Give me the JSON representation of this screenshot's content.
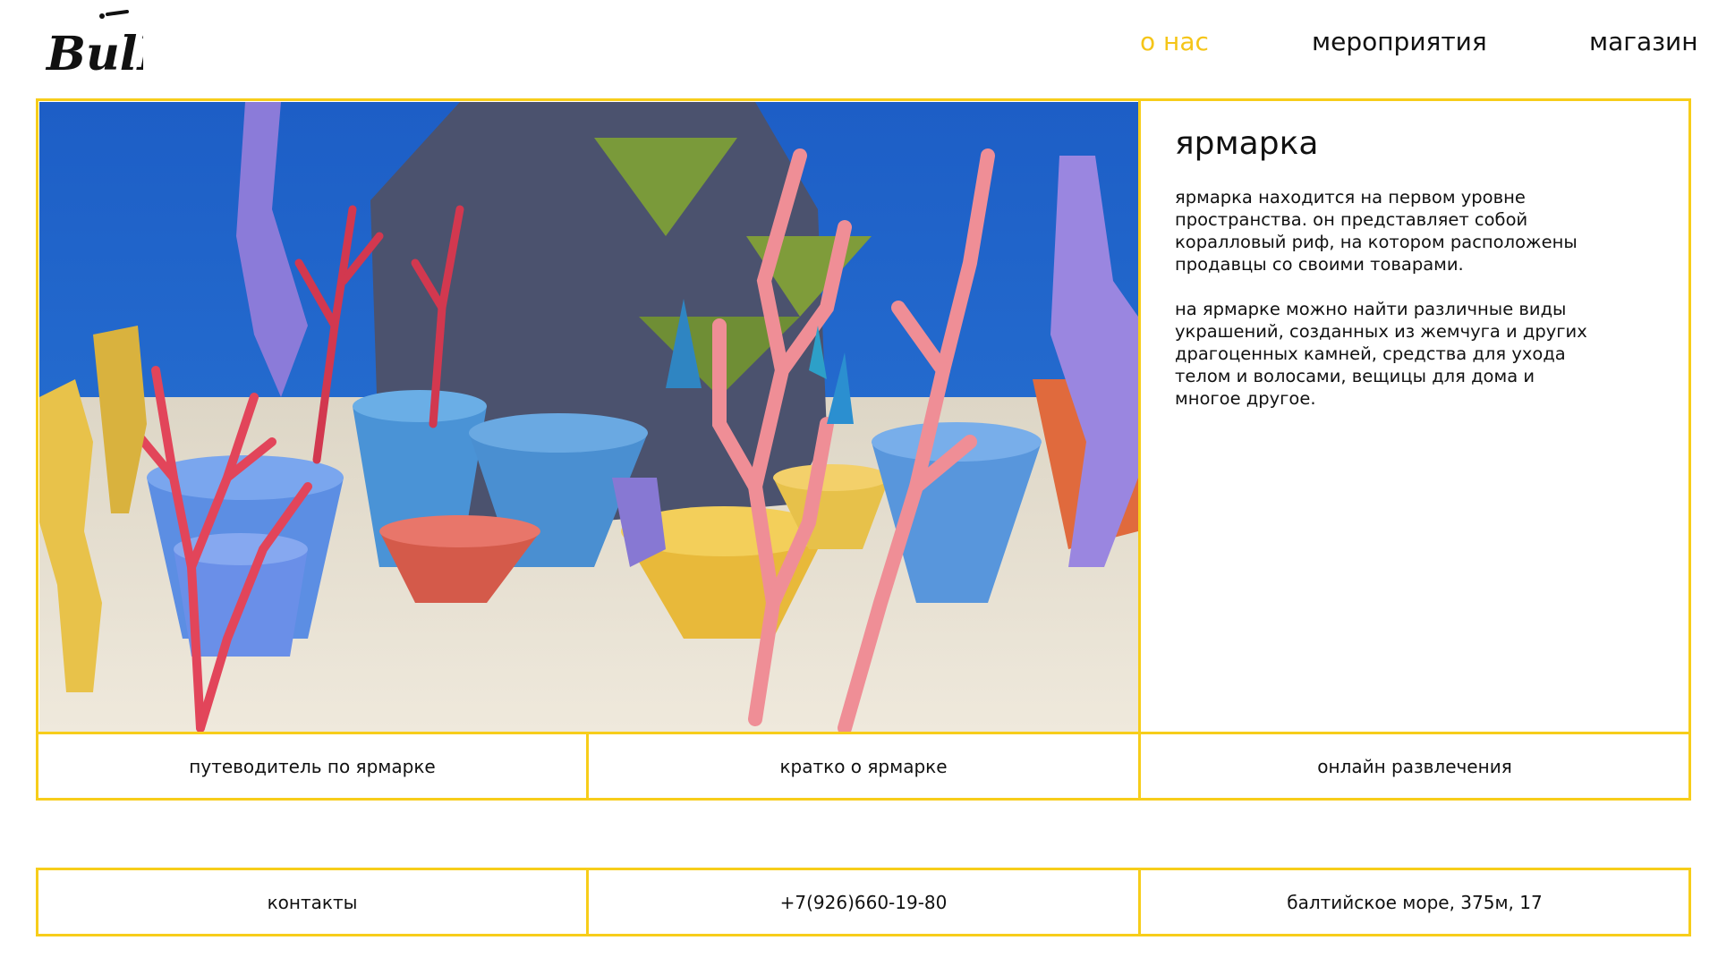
{
  "header": {
    "logo_text": "BulK",
    "nav": [
      {
        "label": "о нас",
        "active": true
      },
      {
        "label": "мероприятия",
        "active": false
      },
      {
        "label": "магазин",
        "active": false
      }
    ]
  },
  "info": {
    "title": "ярмарка",
    "paragraphs": [
      "ярмарка находится на первом уровне пространства. он представляет собой коралловый риф, на котором расположены продавцы со своими товарами.",
      "на ярмарке можно найти различные виды украшений, созданных из жемчуга и других драгоценных камней,  средства для ухода телом и волосами, вещицы для дома и многое другое."
    ]
  },
  "sections": [
    "путеводитель по ярмарке",
    "кратко о ярмарке",
    "онлайн развлечения"
  ],
  "footer": {
    "contacts_label": "контакты",
    "phone": "+7(926)660-19-80",
    "address": "балтийское море, 375м, 17"
  },
  "colors": {
    "accent": "#f7cd1a",
    "active_nav": "#f5c518",
    "sea": "#1f5fc4",
    "sand": "#e8e0cf"
  },
  "hero_image": "coral-reef-3d-render"
}
